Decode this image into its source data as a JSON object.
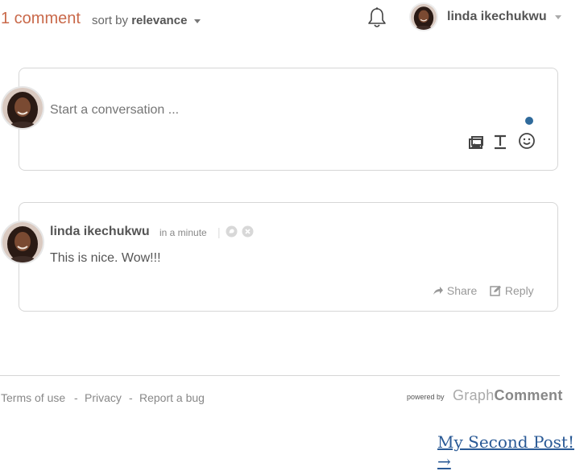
{
  "header": {
    "comment_count": "1 comment",
    "sort_prefix": "sort by",
    "sort_value": "relevance",
    "user_name": "linda ikechukwu"
  },
  "composer": {
    "placeholder": "Start a conversation ..."
  },
  "comments": [
    {
      "author": "linda ikechukwu",
      "time": "in a minute",
      "body": "This is nice. Wow!!!",
      "share_label": "Share",
      "reply_label": "Reply"
    }
  ],
  "footer": {
    "terms": "Terms of use",
    "privacy": "Privacy",
    "report": "Report a bug",
    "separator": "-",
    "powered_by": "powered by",
    "logo_graph": "Graph",
    "logo_comment": "Comment"
  },
  "next_post": "My Second Post! →",
  "colors": {
    "accent": "#c9694a",
    "link": "#2a5a96",
    "notification_dot": "#2f6a9b"
  },
  "icons": [
    "bell-icon",
    "image-icon",
    "text-format-icon",
    "emoji-icon",
    "chat-icon",
    "close-icon",
    "share-icon",
    "reply-icon",
    "chevron-down-icon"
  ]
}
